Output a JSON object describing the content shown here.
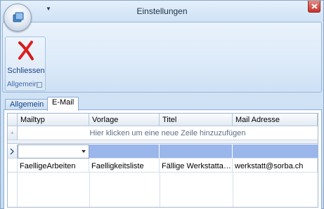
{
  "window": {
    "title": "Einstellungen"
  },
  "ribbon": {
    "close_button_label": "Schliessen",
    "group_caption": "Allgemein"
  },
  "tabs": [
    {
      "label": "Allgemein",
      "active": false
    },
    {
      "label": "E-Mail",
      "active": true
    }
  ],
  "grid": {
    "columns": [
      "Mailtyp",
      "Vorlage",
      "Titel",
      "Mail Adresse"
    ],
    "new_row_hint": "Hier klicken um eine neue Zeile hinzuzufügen",
    "rows": [
      [
        "FaelligeArbeiten",
        "Faelligkeitsliste",
        "Fällige Werkstattar…",
        "werkstatt@sorba.ch"
      ]
    ]
  },
  "colors": {
    "selection": "#9ab6ea",
    "close_red": "#c9302a",
    "accent_blue": "#15428b"
  },
  "icons": [
    "app-orb-icon",
    "quick-access-arrow-icon",
    "close-window-icon",
    "close-x-icon",
    "new-row-star-icon",
    "current-row-arrow-icon",
    "dropdown-arrow-icon",
    "dialog-launcher-icon"
  ]
}
